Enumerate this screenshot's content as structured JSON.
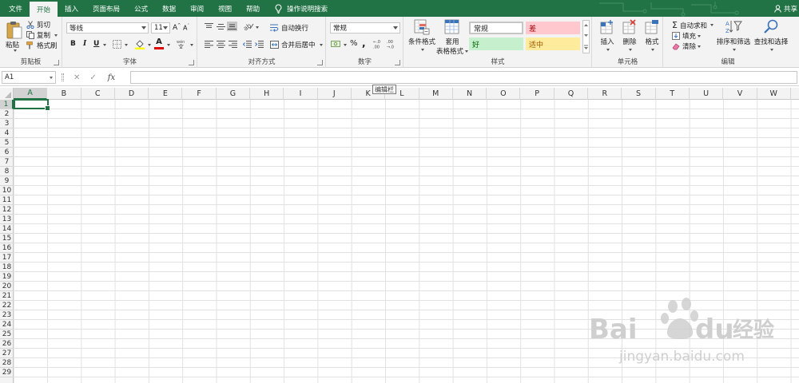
{
  "tabs": [
    "文件",
    "开始",
    "插入",
    "页面布局",
    "公式",
    "数据",
    "审阅",
    "视图",
    "帮助"
  ],
  "active_tab": "开始",
  "tell_me": "操作说明搜索",
  "share": "共享",
  "clipboard": {
    "paste": "粘贴",
    "cut": "剪切",
    "copy": "复制",
    "format_painter": "格式刷",
    "label": "剪贴板"
  },
  "font": {
    "name": "等线",
    "size": "11",
    "bold": "B",
    "italic": "I",
    "underline": "U",
    "label": "字体"
  },
  "alignment": {
    "wrap": "自动换行",
    "merge": "合并后居中",
    "label": "对齐方式"
  },
  "number": {
    "format": "常规",
    "percent": "%",
    "comma": ",",
    "label": "数字"
  },
  "styles": {
    "conditional": "条件格式",
    "table_1": "套用",
    "table_2": "表格格式",
    "normal": "常规",
    "bad": "差",
    "good": "好",
    "neutral": "适中",
    "label": "样式"
  },
  "cells_group": {
    "insert": "插入",
    "delete": "删除",
    "format": "格式",
    "label": "单元格"
  },
  "editing": {
    "autosum": "自动求和",
    "fill": "填充",
    "clear": "清除",
    "sort": "排序和筛选",
    "find": "查找和选择",
    "label": "编辑"
  },
  "formula_bar": {
    "name_box": "A1",
    "cancel": "✕",
    "enter": "✓",
    "fx": "fx",
    "tooltip": "编辑栏"
  },
  "columns": [
    "A",
    "B",
    "C",
    "D",
    "E",
    "F",
    "G",
    "H",
    "I",
    "J",
    "K",
    "L",
    "M",
    "N",
    "O",
    "P",
    "Q",
    "R",
    "S",
    "T",
    "U",
    "V",
    "W"
  ],
  "rows": [
    "1",
    "2",
    "3",
    "4",
    "5",
    "6",
    "7",
    "8",
    "9",
    "10",
    "11",
    "12",
    "13",
    "14",
    "15",
    "16",
    "17",
    "18",
    "19",
    "20",
    "21",
    "22",
    "23",
    "24",
    "25",
    "26",
    "27",
    "28",
    "29"
  ],
  "watermark": {
    "brand_1": "Bai",
    "brand_2": "du",
    "brand_cn": "经验",
    "url": "jingyan.baidu.com"
  },
  "colors": {
    "accent": "#217346",
    "ribbon": "#f3f3f3",
    "bad_bg": "#ffc7ce",
    "bad_fg": "#9c0006",
    "good_bg": "#c6efce",
    "good_fg": "#006100",
    "neutral_bg": "#ffeb9c",
    "neutral_fg": "#9c5700"
  }
}
